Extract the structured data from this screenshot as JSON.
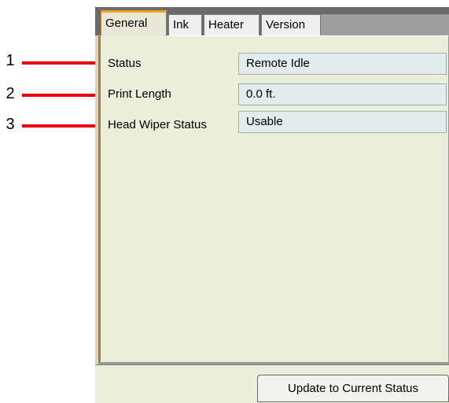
{
  "callouts": [
    "1",
    "2",
    "3"
  ],
  "tabs": [
    "General",
    "Ink",
    "Heater",
    "Version"
  ],
  "active_tab": "General",
  "status": {
    "rows": [
      {
        "label": "Status",
        "value": "Remote Idle"
      },
      {
        "label": "Print Length",
        "value": "0.0 ft."
      },
      {
        "label": "Head Wiper Status",
        "value": "Usable"
      }
    ]
  },
  "footer": {
    "update_button": "Update to Current Status"
  },
  "colors": {
    "callout_line": "#e8000c",
    "active_tab_accent": "#f0a020",
    "panel_bg": "#ebeedb"
  }
}
